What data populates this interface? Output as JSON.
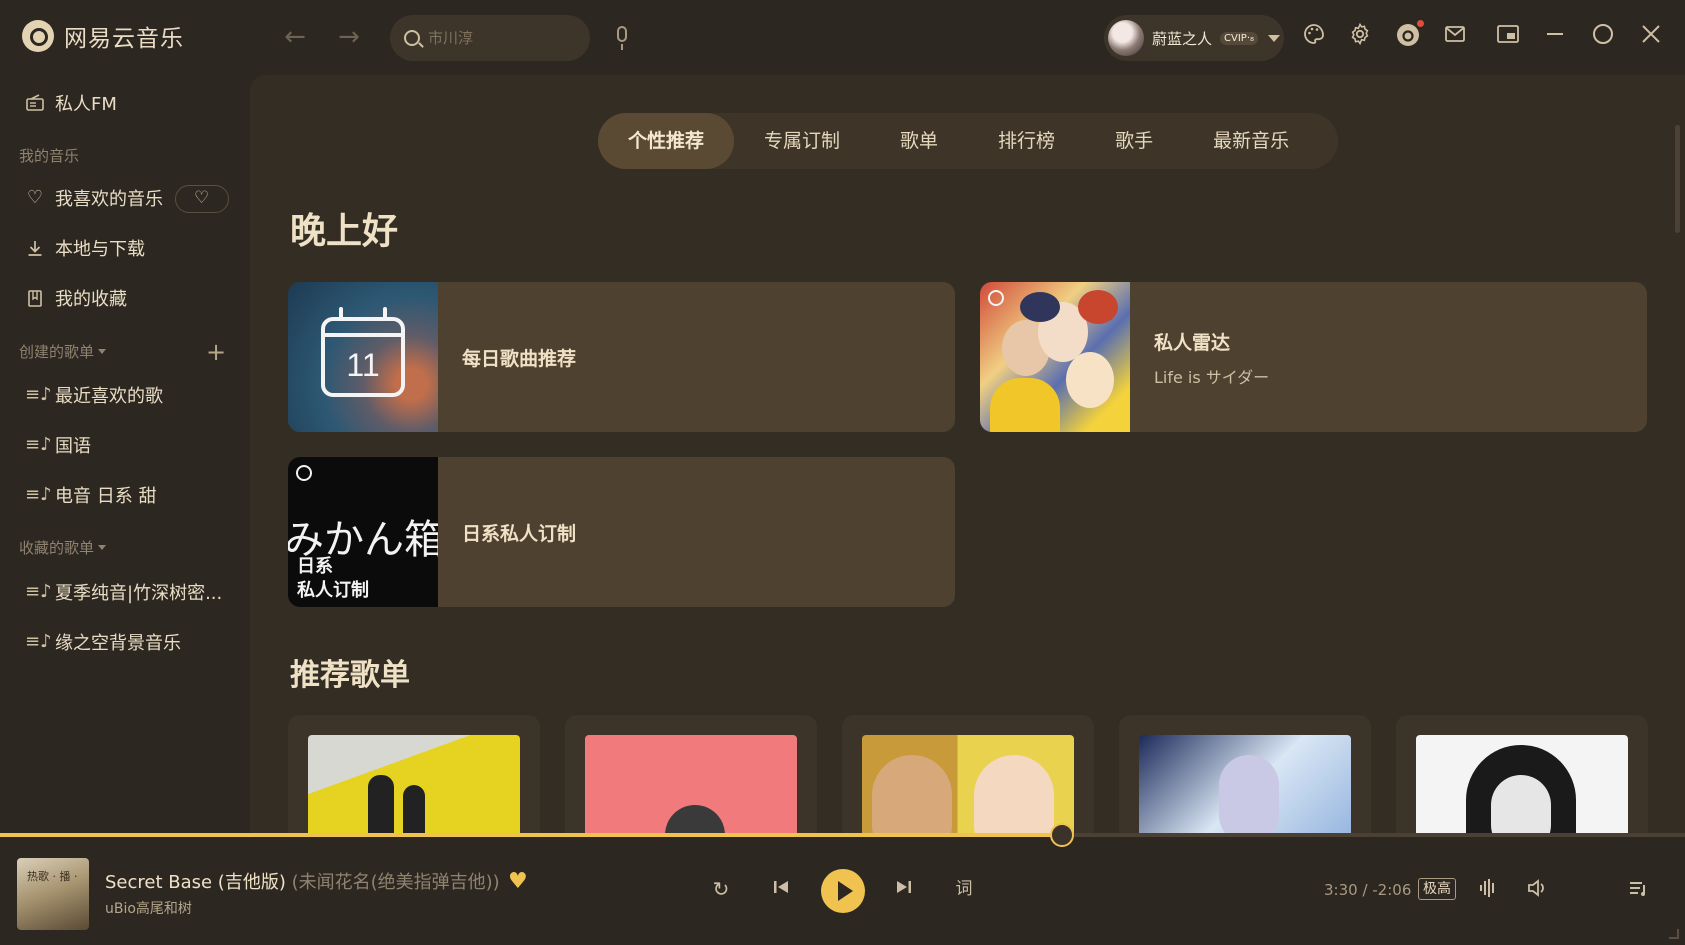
{
  "app": {
    "name": "网易云音乐"
  },
  "search": {
    "placeholder": "市川淳"
  },
  "user": {
    "name": "蔚蓝之人",
    "badge": "CVIP·₈"
  },
  "sidebar": {
    "fm_label": "私人FM",
    "my_music_title": "我的音乐",
    "liked_label": "我喜欢的音乐",
    "download_label": "本地与下载",
    "collection_label": "我的收藏",
    "created_title": "创建的歌单",
    "created_playlists": [
      "最近喜欢的歌",
      "国语",
      "电音 日系 甜"
    ],
    "collected_title": "收藏的歌单",
    "collected_playlists": [
      "夏季纯音|竹深树密...",
      "缘之空背景音乐"
    ]
  },
  "tabs": [
    "个性推荐",
    "专属订制",
    "歌单",
    "排行榜",
    "歌手",
    "最新音乐"
  ],
  "active_tab": 0,
  "greeting": "晚上好",
  "cards": [
    {
      "title": "每日歌曲推荐",
      "subtitle": "",
      "calendar_day": "11"
    },
    {
      "title": "私人雷达",
      "subtitle": "Life is サイダー"
    },
    {
      "title": "日系私人订制",
      "subtitle": "",
      "cover_big_text": "みかん箱",
      "cover_line1": "日系",
      "cover_line2": "私人订制"
    }
  ],
  "recommend_title": "推荐歌单",
  "player": {
    "song_title": "Secret Base (吉他版)",
    "song_alias": "(未闻花名(绝美指弹吉他))",
    "artist": "uBio高尾和树",
    "lyrics_label": "词",
    "time": "3:30 / -2:06",
    "quality": "极高",
    "progress": 0.63,
    "cover_text": "热歌 · 播 ·"
  },
  "colors": {
    "accent": "#f0c24f",
    "background": "#2c2720",
    "panel": "#342d24",
    "card": "#4e412f"
  },
  "icons": {
    "back": "arrow-left-icon",
    "forward": "arrow-right-icon",
    "search": "search-icon",
    "mic": "microphone-icon",
    "theme": "palette-icon",
    "settings": "gear-icon",
    "message": "mail-icon",
    "mini": "mini-player-icon",
    "minimize": "minimize-icon",
    "maximize": "maximize-icon",
    "close": "close-icon"
  }
}
